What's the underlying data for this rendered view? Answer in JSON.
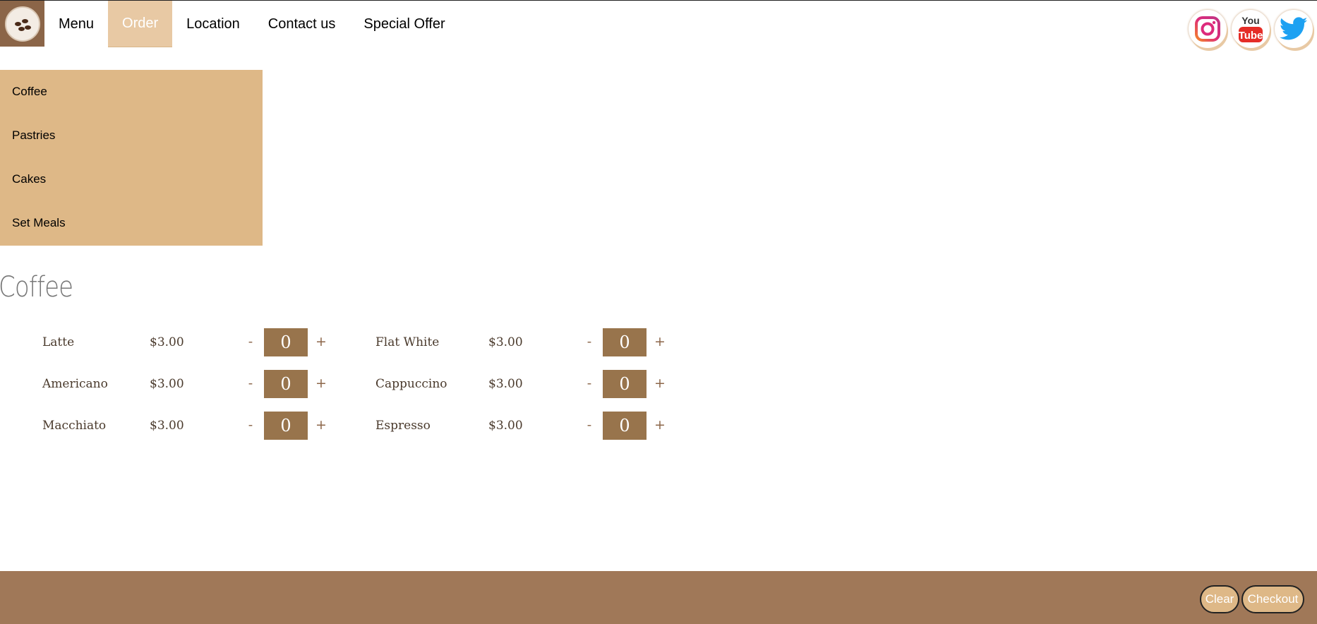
{
  "nav": {
    "items": [
      {
        "label": "Menu"
      },
      {
        "label": "Order"
      },
      {
        "label": "Location"
      },
      {
        "label": "Contact us"
      },
      {
        "label": "Special Offer"
      }
    ],
    "active": "Order"
  },
  "social": [
    "instagram-icon",
    "youtube-icon",
    "twitter-icon"
  ],
  "youtube": {
    "line1": "You",
    "line2": "Tube"
  },
  "categories": [
    {
      "label": "Coffee"
    },
    {
      "label": "Pastries"
    },
    {
      "label": "Cakes"
    },
    {
      "label": "Set Meals"
    }
  ],
  "section": {
    "title": "Coffee"
  },
  "products": [
    {
      "name": "Latte",
      "price": "$3.00",
      "qty": "0",
      "minus": "-",
      "plus": "+"
    },
    {
      "name": "Flat White",
      "price": "$3.00",
      "qty": "0",
      "minus": "-",
      "plus": "+"
    },
    {
      "name": "Americano",
      "price": "$3.00",
      "qty": "0",
      "minus": "-",
      "plus": "+"
    },
    {
      "name": "Cappuccino",
      "price": "$3.00",
      "qty": "0",
      "minus": "-",
      "plus": "+"
    },
    {
      "name": "Macchiato",
      "price": "$3.00",
      "qty": "0",
      "minus": "-",
      "plus": "+"
    },
    {
      "name": "Espresso",
      "price": "$3.00",
      "qty": "0",
      "minus": "-",
      "plus": "+"
    }
  ],
  "footer": {
    "clear_label": "Clear",
    "checkout_label": "Checkout"
  },
  "colors": {
    "brown": "#a07858",
    "tan": "#deb887",
    "qty_bg": "#98744c",
    "active_nav": "#e8c9a4"
  }
}
